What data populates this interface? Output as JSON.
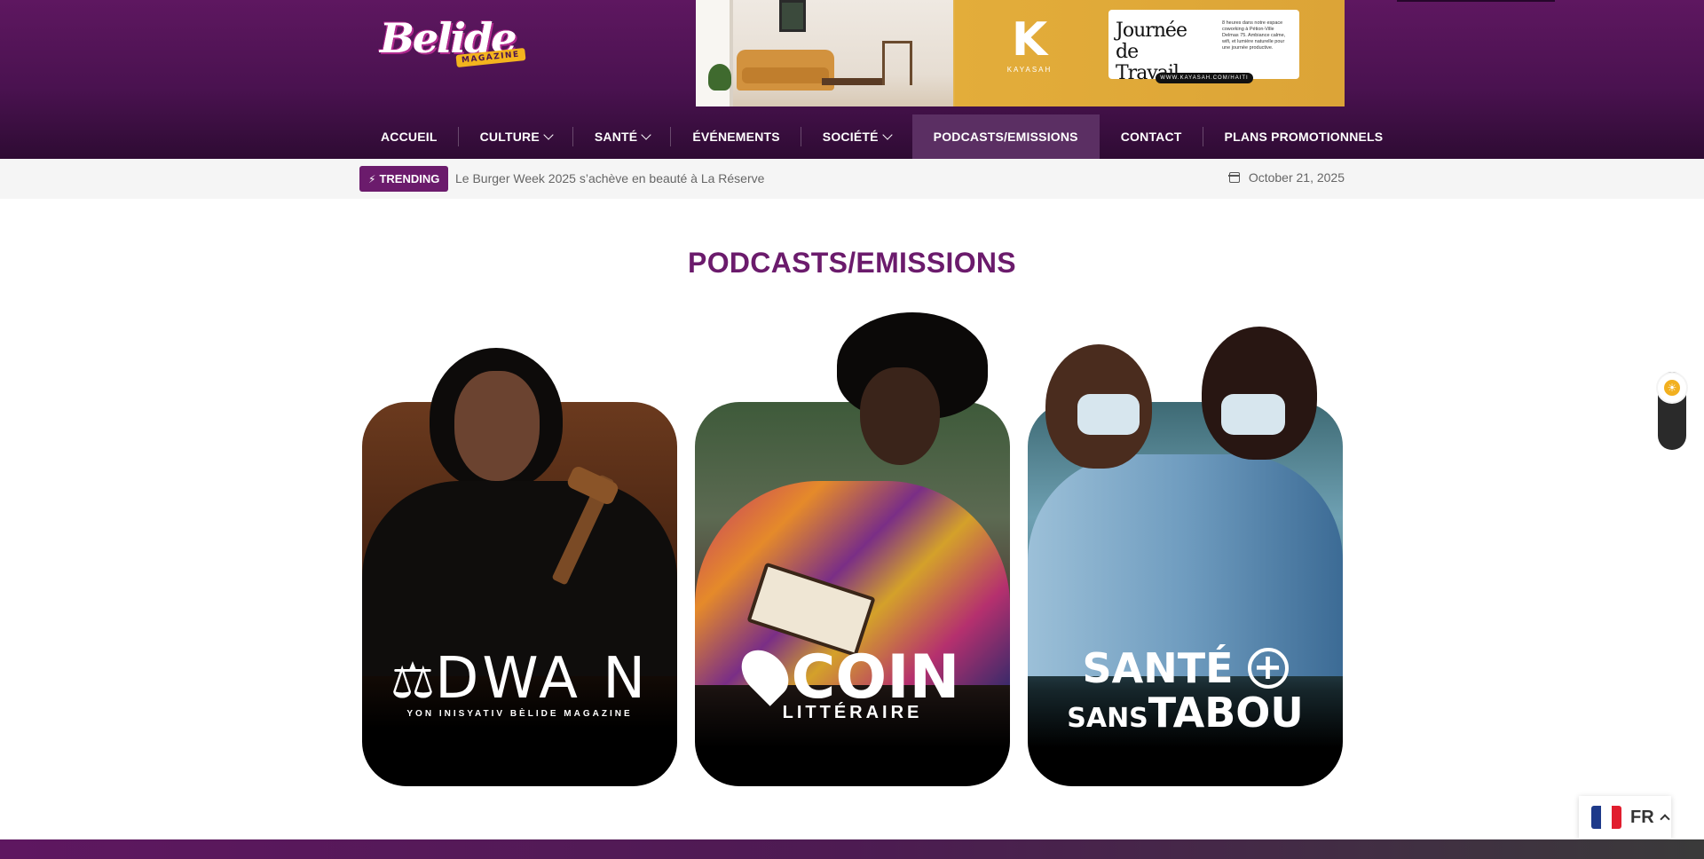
{
  "site": {
    "logo_text": "Belide",
    "logo_tag": "MAGAZINE"
  },
  "ad": {
    "brand": "KAYASAH",
    "brand_mark": "K",
    "headline": "Journée de Travail",
    "body": "8 heures dans notre espace coworking à Pétion-Ville Delmas 75. Ambiance calme, wifi, et lumière naturelle pour une journée productive.",
    "url": "WWW.KAYASAH.COM/HAITI"
  },
  "nav": {
    "items": [
      {
        "label": "ACCUEIL"
      },
      {
        "label": "CULTURE"
      },
      {
        "label": "SANTÉ"
      },
      {
        "label": "ÉVÉNEMENTS"
      },
      {
        "label": "SOCIÉTÉ"
      },
      {
        "label": "PODCASTS/EMISSIONS"
      },
      {
        "label": "CONTACT"
      },
      {
        "label": "PLANS PROMOTIONNELS"
      }
    ],
    "active": "PODCASTS/EMISSIONS"
  },
  "trending": {
    "badge": "TRENDING",
    "headline": "Le Burger Week 2025 s’achève en beauté à La Réserve",
    "date": "October 21, 2025"
  },
  "page": {
    "title": "PODCASTS/EMISSIONS"
  },
  "cards": [
    {
      "logo_main": "WA N",
      "logo_prefix": "D",
      "logo_sub": "YON INISYATIV BÈLIDE MAGAZINE"
    },
    {
      "logo_main": "COIN",
      "logo_sub": "LITTÉRAIRE"
    },
    {
      "logo_line1": "SANTÉ",
      "logo_line2_small": "SANS",
      "logo_line2": "TABOU"
    }
  ],
  "language": {
    "current": "FR",
    "flag_colors": [
      "#1e3a8a",
      "#ffffff",
      "#e11d2e"
    ]
  },
  "icons": {
    "trending": "bolt-icon",
    "date": "calendar-icon",
    "theme": "sun-icon",
    "language": "chevron-up-icon"
  },
  "colors": {
    "brand": "#6b1b6c",
    "header_bg": "#4a1250",
    "nav_active": "#5b2f63",
    "accent": "#f2b01f"
  }
}
